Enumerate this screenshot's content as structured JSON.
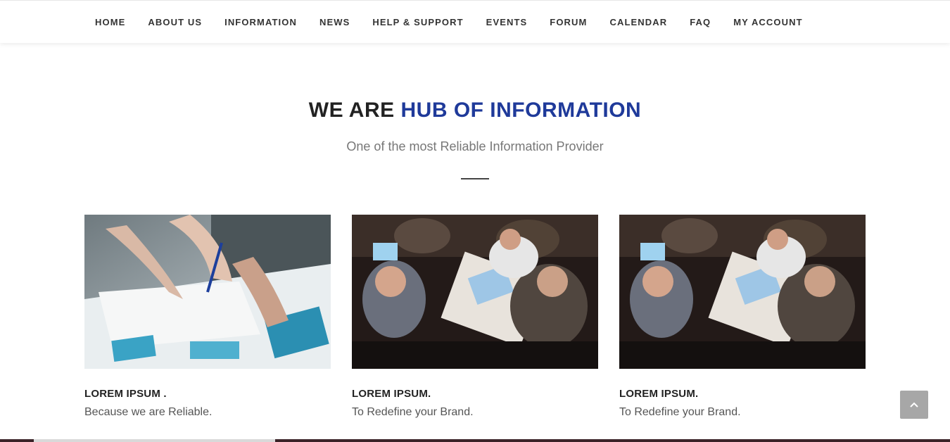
{
  "nav": {
    "items": [
      {
        "label": "HOME"
      },
      {
        "label": "ABOUT US"
      },
      {
        "label": "INFORMATION"
      },
      {
        "label": "NEWS"
      },
      {
        "label": "HELP & SUPPORT"
      },
      {
        "label": "EVENTS"
      },
      {
        "label": "FORUM"
      },
      {
        "label": "CALENDAR"
      },
      {
        "label": "FAQ"
      },
      {
        "label": "MY ACCOUNT"
      }
    ]
  },
  "hero": {
    "heading_plain": "WE ARE",
    "heading_accent": "HUB OF INFORMATION",
    "subheading": "One of the most Reliable Information Provider"
  },
  "cards": [
    {
      "title": "LOREM IPSUM .",
      "description": "Because we are Reliable."
    },
    {
      "title": "LOREM IPSUM.",
      "description": "To Redefine your Brand."
    },
    {
      "title": "LOREM IPSUM.",
      "description": "To Redefine your Brand."
    }
  ],
  "colors": {
    "accent": "#1f3a9a",
    "scroll_button": "#a7a7a7"
  },
  "scroll_top_icon": "chevron-up-icon"
}
